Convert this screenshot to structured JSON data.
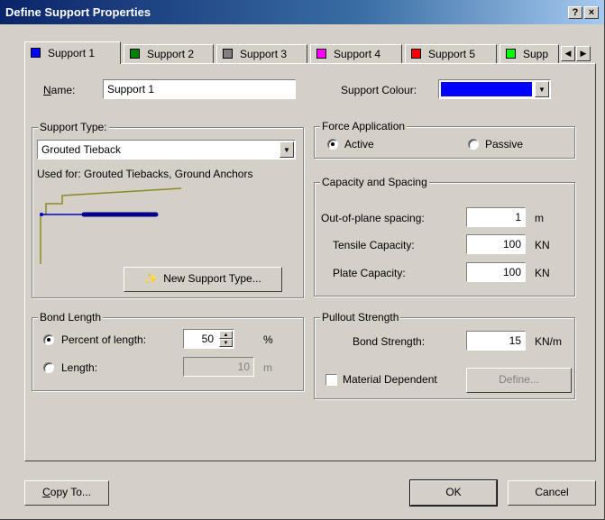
{
  "window": {
    "title": "Define Support Properties",
    "help_label": "?",
    "close_label": "×"
  },
  "tabs": [
    {
      "label": "Support 1",
      "color": "#0000ff"
    },
    {
      "label": "Support 2",
      "color": "#008000"
    },
    {
      "label": "Support 3",
      "color": "#808080"
    },
    {
      "label": "Support 4",
      "color": "#ff00ff"
    },
    {
      "label": "Support 5",
      "color": "#ff0000"
    },
    {
      "label": "Supp",
      "color": "#00ff00"
    }
  ],
  "name": {
    "label": "Name:",
    "value": "Support 1"
  },
  "support_colour": {
    "label": "Support Colour:",
    "value": "#0000ff"
  },
  "support_type": {
    "legend": "Support Type:",
    "selected": "Grouted Tieback",
    "used_for": "Used for: Grouted Tiebacks, Ground Anchors",
    "new_button": "New Support Type..."
  },
  "force_application": {
    "legend": "Force Application",
    "active_label": "Active",
    "passive_label": "Passive",
    "selected": "Active"
  },
  "capacity": {
    "legend": "Capacity and Spacing",
    "rows": [
      {
        "label": "Out-of-plane spacing:",
        "value": "1",
        "unit": "m"
      },
      {
        "label": "Tensile Capacity:",
        "value": "100",
        "unit": "KN"
      },
      {
        "label": "Plate Capacity:",
        "value": "100",
        "unit": "KN"
      }
    ]
  },
  "bond_length": {
    "legend": "Bond Length",
    "percent_label": "Percent of length:",
    "percent_value": "50",
    "percent_unit": "%",
    "length_label": "Length:",
    "length_value": "10",
    "length_unit": "m",
    "selected": "Percent of length"
  },
  "pullout": {
    "legend": "Pullout Strength",
    "bond_label": "Bond Strength:",
    "bond_value": "15",
    "bond_unit": "KN/m",
    "material_dependent_label": "Material Dependent",
    "material_dependent_checked": false,
    "define_button": "Define..."
  },
  "footer": {
    "copy_button": "Copy To...",
    "ok_button": "OK",
    "cancel_button": "Cancel"
  }
}
